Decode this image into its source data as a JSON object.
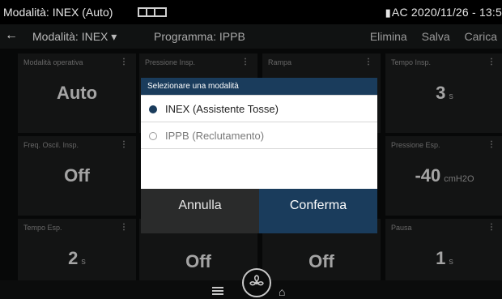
{
  "status": {
    "mode_title": "Modalità: INEX (Auto)",
    "power": "AC",
    "datetime": "2020/11/26 - 13:5"
  },
  "toolbar": {
    "back_icon": "arrow-left-icon",
    "mode": "Modalità: INEX",
    "program": "Programma: IPPB",
    "delete_label": "Elimina",
    "save_label": "Salva",
    "load_label": "Carica"
  },
  "cards": [
    {
      "label": "Modalità operativa",
      "value": "Auto",
      "unit": ""
    },
    {
      "label": "Pressione Insp.",
      "value": "",
      "unit": ""
    },
    {
      "label": "Rampa",
      "value": "",
      "unit": ""
    },
    {
      "label": "Tempo Insp.",
      "value": "3",
      "unit": "s"
    },
    {
      "label": "Freq. Oscil. Insp.",
      "value": "Off",
      "unit": ""
    },
    {
      "label": "Pressione Esp.",
      "value": "-40",
      "unit": "cmH2O"
    },
    {
      "label": "Tempo Esp.",
      "value": "2",
      "unit": "s"
    },
    {
      "label": "",
      "value": "Off",
      "unit": ""
    },
    {
      "label": "",
      "value": "Off",
      "unit": ""
    },
    {
      "label": "Pausa",
      "value": "1",
      "unit": "s"
    }
  ],
  "dialog": {
    "title": "Selezionare una modalità",
    "options": [
      {
        "label": "INEX (Assistente Tosse)",
        "selected": true
      },
      {
        "label": "IPPB (Reclutamento)",
        "selected": false
      }
    ],
    "cancel_label": "Annulla",
    "confirm_label": "Conferma"
  },
  "colors": {
    "accent": "#1a3c5c",
    "background": "#0b0c0c",
    "card": "#1b1c1c"
  }
}
